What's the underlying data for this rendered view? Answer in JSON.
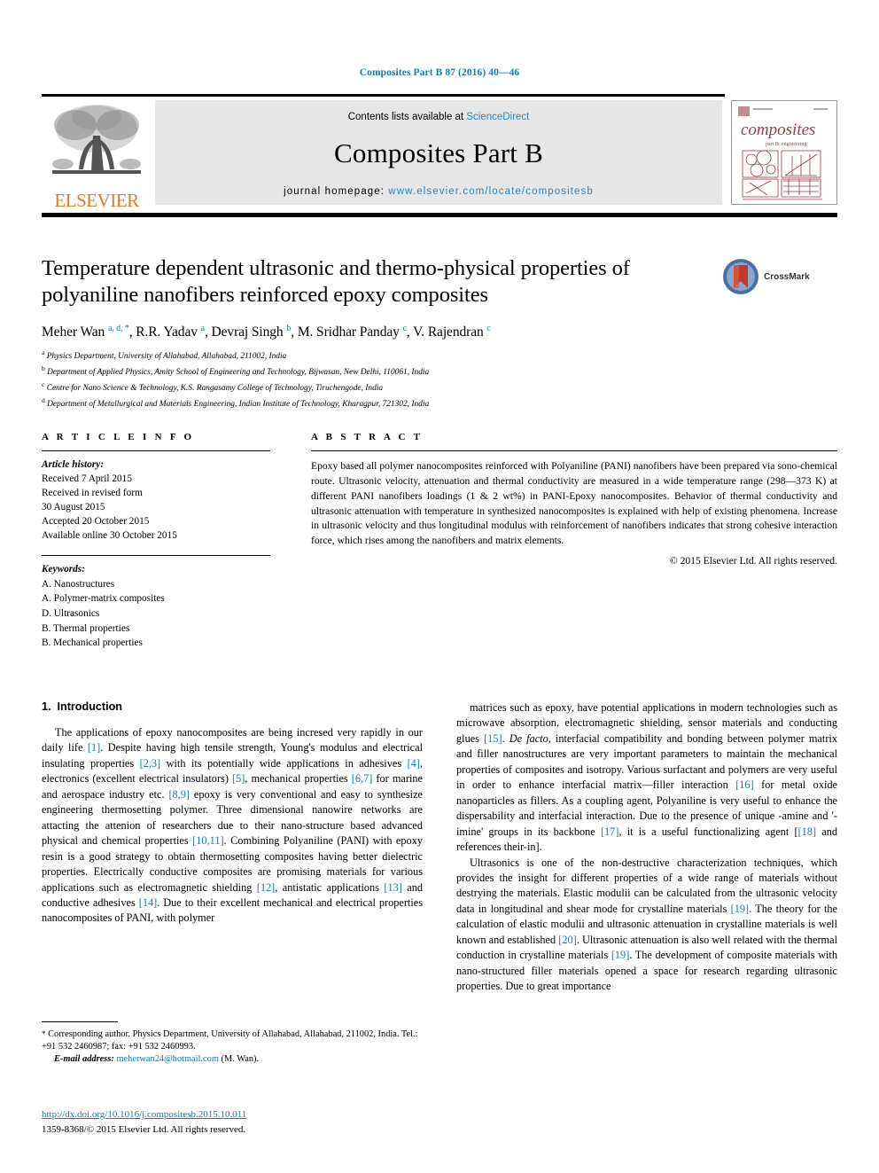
{
  "running_head": "Composites Part B 87 (2016) 40—46",
  "masthead": {
    "contents_prefix": "Contents lists available at ",
    "contents_link": "ScienceDirect",
    "journal_title": "Composites Part B",
    "homepage_label": "journal homepage: ",
    "homepage_url": "www.elsevier.com/locate/compositesb",
    "publisher_wordmark": "ELSEVIER",
    "cover_title": "composites",
    "cover_subtitle": "part B: engineering"
  },
  "article": {
    "title": "Temperature dependent ultrasonic and thermo-physical properties of polyaniline nanofibers reinforced epoxy composites",
    "crossmark_label": "CrossMark",
    "authors_html": "Meher Wan <sup class=\"aff-sup\">a, d, *</sup>, R.R. Yadav <sup class=\"aff-sup\">a</sup>, Devraj Singh <sup class=\"aff-sup\">b</sup>, M. Sridhar Panday <sup class=\"aff-sup\">c</sup>, V. Rajendran <sup class=\"aff-sup\">c</sup>",
    "affiliations": [
      {
        "mark": "a",
        "text": "Physics Department, University of Allahabad, Allahabad, 211002, India"
      },
      {
        "mark": "b",
        "text": "Department of Applied Physics, Amity School of Engineering and Technology, Bijwasan, New Delhi, 110061, India"
      },
      {
        "mark": "c",
        "text": "Centre for Nano Science & Technology, K.S. Rangasamy College of Technology, Tiruchengode, India"
      },
      {
        "mark": "d",
        "text": "Department of Metallurgical and Materials Engineering, Indian Institute of Technology, Kharagpur, 721302, India"
      }
    ]
  },
  "article_info": {
    "heading": "A R T I C L E   I N F O",
    "history_label": "Article history:",
    "history": [
      "Received 7 April 2015",
      "Received in revised form",
      "30 August 2015",
      "Accepted 20 October 2015",
      "Available online 30 October 2015"
    ],
    "keywords_label": "Keywords:",
    "keywords": [
      "A. Nanostructures",
      "A. Polymer-matrix composites",
      "D. Ultrasonics",
      "B. Thermal properties",
      "B. Mechanical properties"
    ]
  },
  "abstract": {
    "heading": "A B S T R A C T",
    "text": "Epoxy based all polymer nanocomposites reinforced with Polyaniline (PANI) nanofibers have been prepared via sono-chemical route. Ultrasonic velocity, attenuation and thermal conductivity are measured in a wide temperature range (298—373 K) at different PANI nanofibers loadings (1 & 2 wt%) in PANI-Epoxy nanocomposites. Behavior of thermal conductivity and ultrasonic attenuation with temperature in synthesized nanocomposites is explained with help of existing phenomena. Increase in ultrasonic velocity and thus longitudinal modulus with reinforcement of nanofibers indicates that strong cohesive interaction force, which rises among the nanofibers and matrix elements.",
    "copyright": "© 2015 Elsevier Ltd. All rights reserved."
  },
  "body": {
    "section_number": "1.",
    "section_title": "Introduction",
    "left_paragraph_html": "The applications of epoxy nanocomposites are being incresed very rapidly in our daily life <span class=\"ref\">[1]</span>. Despite having high tensile strength, Young's modulus and electrical insulating properties <span class=\"ref\">[2,3]</span> with its potentially wide applications in adhesives <span class=\"ref\">[4]</span>, electronics (excellent electrical insulators) <span class=\"ref\">[5]</span>, mechanical properties <span class=\"ref\">[6,7]</span> for marine and aerospace industry etc. <span class=\"ref\">[8,9]</span> epoxy is very conventional and easy to synthesize engineering thermosetting polymer. Three dimensional nanowire networks are attacting the attenion of researchers due to their nano-structure based advanced physical and chemical properties <span class=\"ref\">[10,11]</span>. Combining Polyaniline (PANI) with epoxy resin is a good strategy to obtain thermosetting composites having better dielectric properties. Electrically conductive composites are promising materials for various applications such as electromagnetic shielding <span class=\"ref\">[12]</span>, antistatic applications <span class=\"ref\">[13]</span> and conductive adhesives <span class=\"ref\">[14]</span>. Due to their excellent mechanical and electrical properties nanocomposites of PANI, with polymer",
    "right_paragraph_1_html": "matrices such as epoxy, have potential applications in modern technologies such as microwave absorption, electromagnetic shielding, sensor materials and conducting glues <span class=\"ref\">[15]</span>. <span class=\"it\">De facto</span>, interfacial compatibility and bonding between polymer matrix and filler nanostructures are very important parameters to maintain the mechanical properties of composites and isotropy. Various surfactant and polymers are very useful in order to enhance interfacial matrix—filler interaction <span class=\"ref\">[16]</span> for metal oxide nanoparticles as fillers. As a coupling agent, Polyaniline is very useful to enhance the dispersability and interfacial interaction. Due to the presence of unique -amine and '-imine' groups in its backbone <span class=\"ref\">[17]</span>, it is a useful functionalizing agent [<span class=\"ref\">[18]</span> and references their-in].",
    "right_paragraph_2_html": "Ultrasonics is one of the non-destructive characterization techniques, which provides the insight for different properties of a wide range of materials without destrying the materials. Elastic modulii can be calculated from the ultrasonic velocity data in longitudinal and shear mode for crystalline materials <span class=\"ref\">[19]</span>. The theory for the calculation of elastic modulii and ultrasonic attenuation in crystalline materials is well known and established <span class=\"ref\">[20]</span>. Ultrasonic attenuation is also well related with the thermal conduction in crystalline materials <span class=\"ref\">[19]</span>. The development of composite materials with nano-structured filler materials opened a space for research regarding ultrasonic properties. Due to great importance"
  },
  "footnote": {
    "corresponding_html": "<span class=\"fn-star\">*</span> Corresponding author. Physics Department, University of Allahabad, Allahabad, 211002, India. Tel.: +91 532 2460987; fax: +91 532 2460993.",
    "email_label": "E-mail address:",
    "email": "meherwan24@hotmail.com",
    "email_owner": "(M. Wan).",
    "doi": "http://dx.doi.org/10.1016/j.compositesb.2015.10.011",
    "issn_line": "1359-8368/© 2015 Elsevier Ltd. All rights reserved."
  },
  "colors": {
    "link_blue": "#1a7aad",
    "elsevier_orange": "#E87722",
    "masthead_grey": "#e6e6e6"
  }
}
